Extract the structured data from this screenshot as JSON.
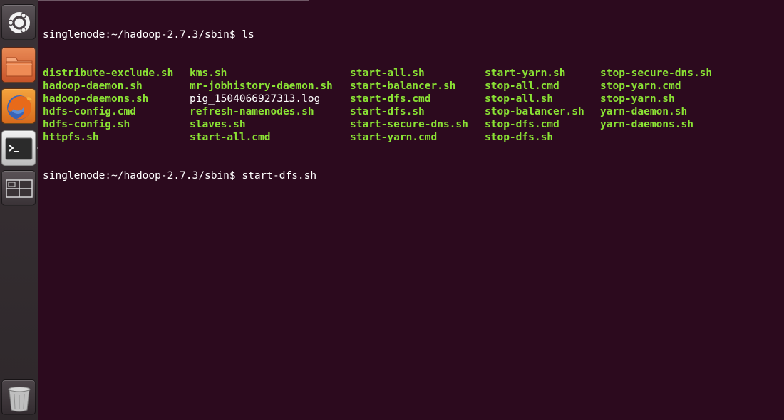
{
  "launcher": {
    "items": [
      {
        "name": "dash-home",
        "icon": "ubuntu-logo-icon"
      },
      {
        "name": "files",
        "icon": "folder-icon"
      },
      {
        "name": "firefox",
        "icon": "firefox-icon"
      },
      {
        "name": "terminal",
        "icon": "terminal-icon",
        "active": true
      },
      {
        "name": "workspaces",
        "icon": "workspace-switcher-icon"
      },
      {
        "name": "trash",
        "icon": "trash-icon"
      }
    ]
  },
  "terminal": {
    "prompt": "singlenode:~/hadoop-2.7.3/sbin$",
    "command1": "ls",
    "command2": "start-dfs.sh",
    "exe_color": "#8ae234",
    "background": "#2c0a1e",
    "listing": [
      [
        "distribute-exclude.sh",
        "kms.sh",
        "start-all.sh",
        "start-yarn.sh",
        "stop-secure-dns.sh"
      ],
      [
        "hadoop-daemon.sh",
        "mr-jobhistory-daemon.sh",
        "start-balancer.sh",
        "stop-all.cmd",
        "stop-yarn.cmd"
      ],
      [
        "hadoop-daemons.sh",
        "pig_1504066927313.log",
        "start-dfs.cmd",
        "stop-all.sh",
        "stop-yarn.sh"
      ],
      [
        "hdfs-config.cmd",
        "refresh-namenodes.sh",
        "start-dfs.sh",
        "stop-balancer.sh",
        "yarn-daemon.sh"
      ],
      [
        "hdfs-config.sh",
        "slaves.sh",
        "start-secure-dns.sh",
        "stop-dfs.cmd",
        "yarn-daemons.sh"
      ],
      [
        "httpfs.sh",
        "start-all.cmd",
        "start-yarn.cmd",
        "stop-dfs.sh",
        ""
      ]
    ]
  }
}
